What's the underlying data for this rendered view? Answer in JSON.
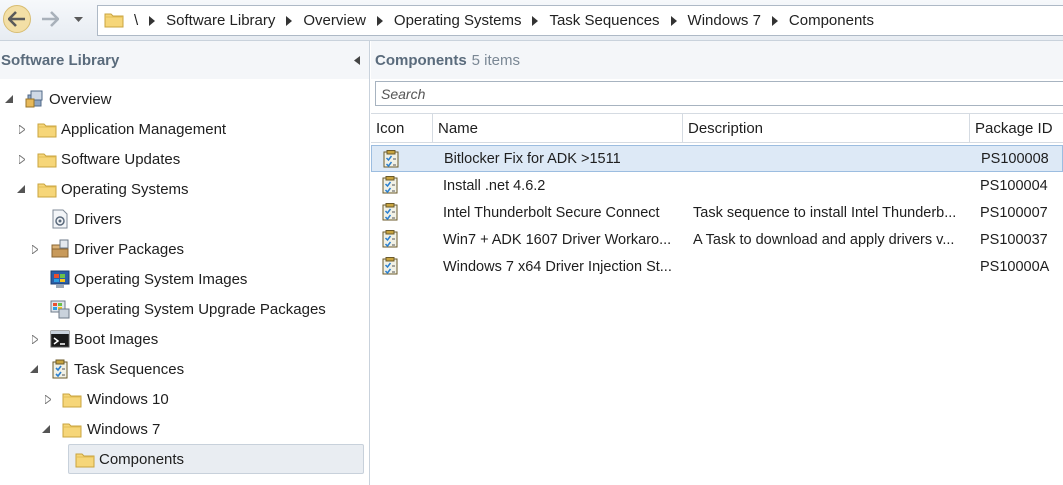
{
  "breadcrumb": {
    "root": "\\",
    "items": [
      "Software Library",
      "Overview",
      "Operating Systems",
      "Task Sequences",
      "Windows 7",
      "Components"
    ]
  },
  "tree": {
    "title": "Software Library",
    "nodes": [
      {
        "label": "Overview",
        "icon": "overview-icon",
        "expanded": true
      },
      {
        "label": "Application Management",
        "icon": "folder-icon",
        "expanded": false
      },
      {
        "label": "Software Updates",
        "icon": "folder-icon",
        "expanded": false
      },
      {
        "label": "Operating Systems",
        "icon": "folder-icon",
        "expanded": true
      },
      {
        "label": "Drivers",
        "icon": "drivers-icon"
      },
      {
        "label": "Driver Packages",
        "icon": "driver-packages-icon",
        "expanded": false
      },
      {
        "label": "Operating System Images",
        "icon": "os-images-icon"
      },
      {
        "label": "Operating System Upgrade Packages",
        "icon": "os-upgrade-icon"
      },
      {
        "label": "Boot Images",
        "icon": "boot-images-icon",
        "expanded": false
      },
      {
        "label": "Task Sequences",
        "icon": "task-sequence-icon",
        "expanded": true
      },
      {
        "label": "Windows 10",
        "icon": "folder-icon",
        "expanded": false
      },
      {
        "label": "Windows 7",
        "icon": "folder-icon",
        "expanded": true
      },
      {
        "label": "Components",
        "icon": "folder-icon",
        "selected": true
      }
    ]
  },
  "list": {
    "title": "Components",
    "count": "5 items",
    "search_placeholder": "Search",
    "columns": [
      "Icon",
      "Name",
      "Description",
      "Package ID"
    ],
    "rows": [
      {
        "name": "Bitlocker Fix for ADK >1511",
        "description": "",
        "package_id": "PS100008",
        "selected": true
      },
      {
        "name": "Install .net 4.6.2",
        "description": "",
        "package_id": "PS100004"
      },
      {
        "name": "Intel Thunderbolt Secure Connect",
        "description": "Task sequence to install Intel Thunderb...",
        "package_id": "PS100007"
      },
      {
        "name": "Win7 + ADK 1607 Driver Workaro...",
        "description": "A Task to download and apply drivers v...",
        "package_id": "PS100037"
      },
      {
        "name": "Windows 7 x64 Driver Injection St...",
        "description": "",
        "package_id": "PS10000A"
      }
    ]
  },
  "colors": {
    "accent_back": "#f3dfa6",
    "selection": "#dde9f6",
    "pane_header_text": "#5a6b7c",
    "folder": "#f6d679"
  }
}
